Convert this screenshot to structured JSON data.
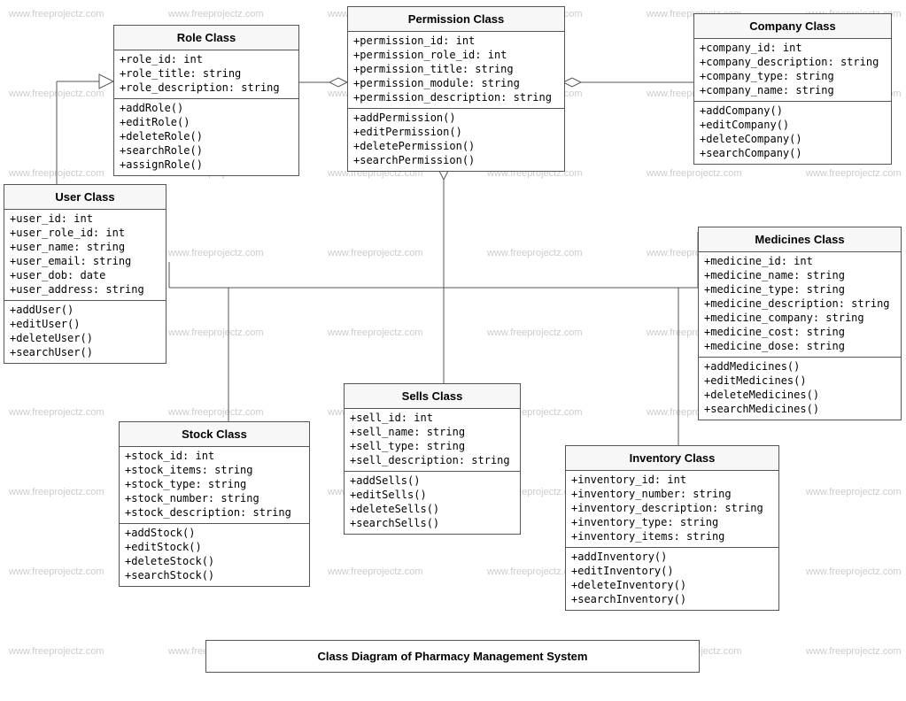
{
  "title": "Class Diagram of Pharmacy Management System",
  "watermark": "www.freeprojectz.com",
  "classes": {
    "role": {
      "name": "Role Class",
      "attrs": [
        "+role_id: int",
        "+role_title: string",
        "+role_description: string"
      ],
      "ops": [
        "+addRole()",
        "+editRole()",
        "+deleteRole()",
        "+searchRole()",
        "+assignRole()"
      ]
    },
    "permission": {
      "name": "Permission Class",
      "attrs": [
        "+permission_id: int",
        "+permission_role_id: int",
        "+permission_title: string",
        "+permission_module: string",
        "+permission_description: string"
      ],
      "ops": [
        "+addPermission()",
        "+editPermission()",
        "+deletePermission()",
        "+searchPermission()"
      ]
    },
    "company": {
      "name": "Company Class",
      "attrs": [
        "+company_id: int",
        "+company_description: string",
        "+company_type: string",
        "+company_name: string"
      ],
      "ops": [
        "+addCompany()",
        "+editCompany()",
        "+deleteCompany()",
        "+searchCompany()"
      ]
    },
    "user": {
      "name": "User Class",
      "attrs": [
        "+user_id: int",
        "+user_role_id: int",
        "+user_name: string",
        "+user_email: string",
        "+user_dob: date",
        "+user_address: string"
      ],
      "ops": [
        "+addUser()",
        "+editUser()",
        "+deleteUser()",
        "+searchUser()"
      ]
    },
    "medicines": {
      "name": "Medicines Class",
      "attrs": [
        "+medicine_id: int",
        "+medicine_name: string",
        "+medicine_type: string",
        "+medicine_description: string",
        "+medicine_company: string",
        "+medicine_cost: string",
        "+medicine_dose: string"
      ],
      "ops": [
        "+addMedicines()",
        "+editMedicines()",
        "+deleteMedicines()",
        "+searchMedicines()"
      ]
    },
    "stock": {
      "name": "Stock Class",
      "attrs": [
        "+stock_id: int",
        "+stock_items: string",
        "+stock_type: string",
        "+stock_number: string",
        "+stock_description: string"
      ],
      "ops": [
        "+addStock()",
        "+editStock()",
        "+deleteStock()",
        "+searchStock()"
      ]
    },
    "sells": {
      "name": "Sells Class",
      "attrs": [
        "+sell_id: int",
        "+sell_name: string",
        "+sell_type: string",
        "+sell_description: string"
      ],
      "ops": [
        "+addSells()",
        "+editSells()",
        "+deleteSells()",
        "+searchSells()"
      ]
    },
    "inventory": {
      "name": "Inventory Class",
      "attrs": [
        "+inventory_id: int",
        "+inventory_number: string",
        "+inventory_description: string",
        "+inventory_type: string",
        "+inventory_items: string"
      ],
      "ops": [
        "+addInventory()",
        "+editInventory()",
        "+deleteInventory()",
        "+searchInventory()"
      ]
    }
  }
}
